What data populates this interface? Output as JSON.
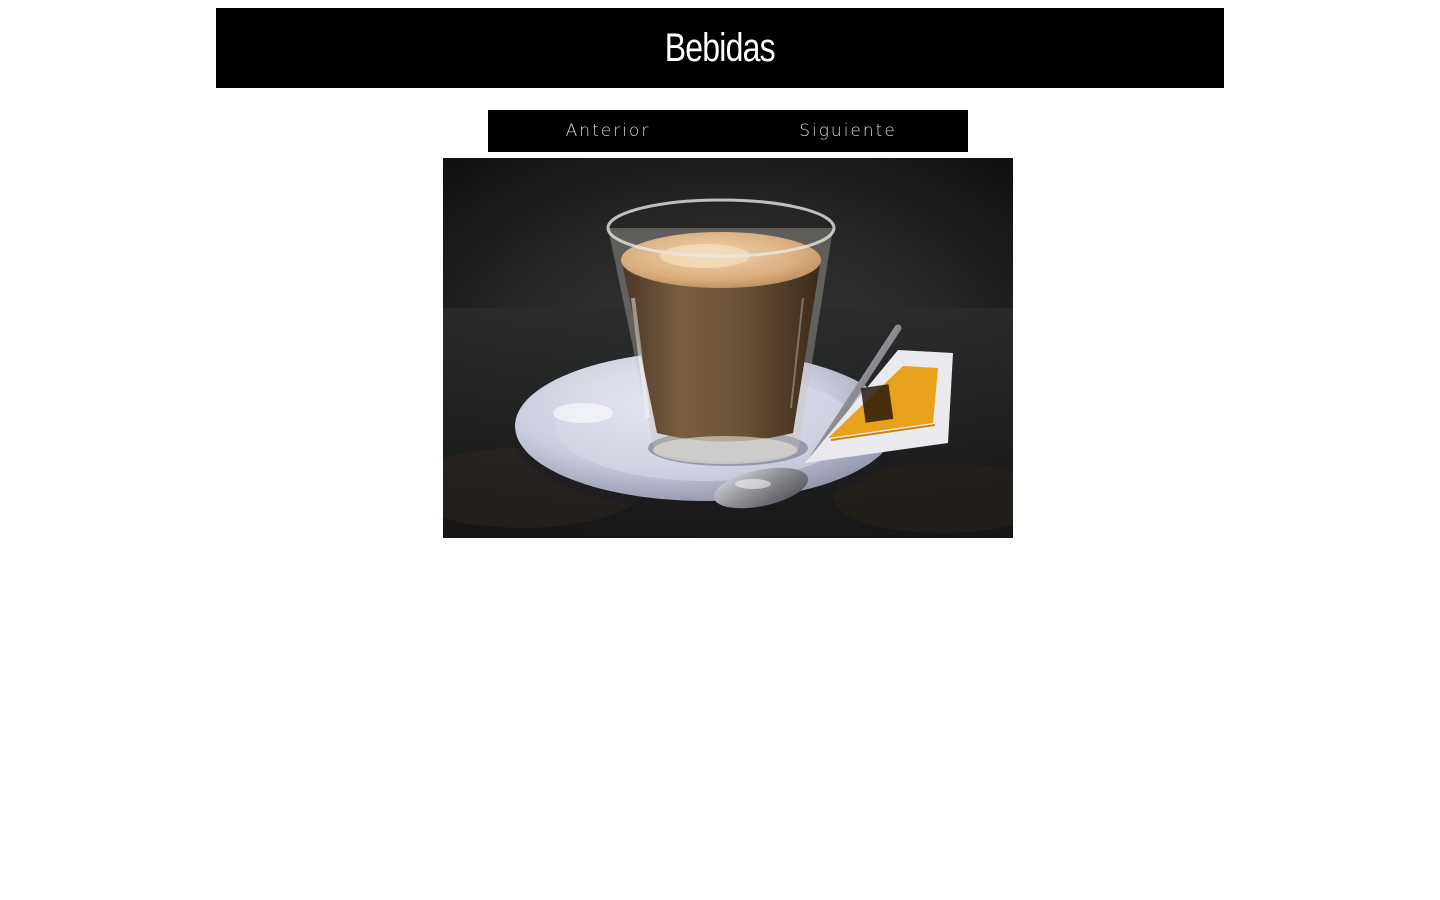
{
  "header": {
    "title": "Bebidas"
  },
  "nav": {
    "prev_label": "Anterior",
    "next_label": "Siguiente"
  },
  "photo": {
    "subject": "cortado coffee in glass on white saucer with spoon and sugar packet"
  },
  "colors": {
    "header_bg": "#000000",
    "header_text": "#ffffff",
    "nav_bg": "#000000",
    "nav_text": "#d8d8d8",
    "page_bg": "#ffffff"
  }
}
